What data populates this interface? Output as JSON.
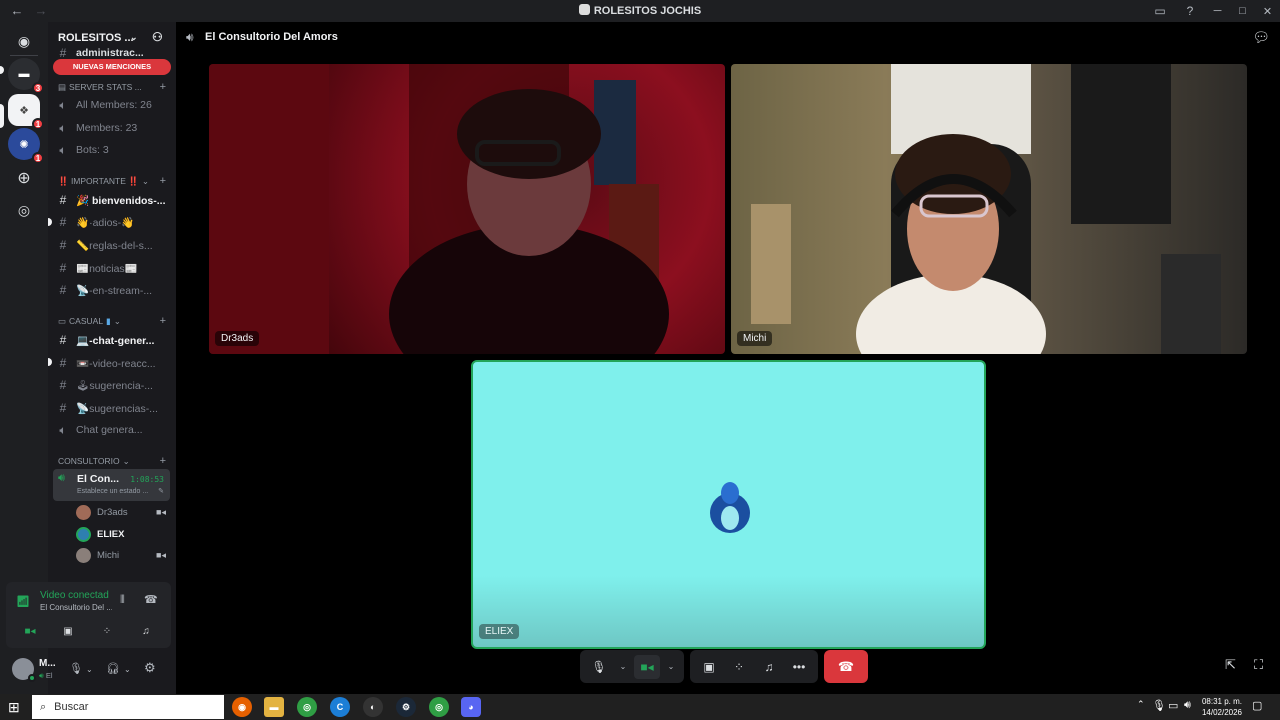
{
  "window": {
    "title": "ROLESITOS JOCHIS"
  },
  "rail": {
    "servers": [
      {
        "name": "direct-messages-icon"
      },
      {
        "badge": "3"
      },
      {
        "badge": "1"
      },
      {
        "badge": "1"
      }
    ]
  },
  "sidebar": {
    "server_name": "ROLESITOS ...",
    "top_channel": "administrac...",
    "top_channel_badge": "1",
    "new_mentions": "NUEVAS MENCIONES",
    "categories": {
      "stats": "SERVER STATS ...",
      "importante": "‼️ IMPORTANTE ‼️",
      "casual": "CASUAL",
      "consultorio": "CONSULTORIO"
    },
    "stats_channels": [
      "All Members: 26",
      "Members: 23",
      "Bots: 3"
    ],
    "importante_channels": [
      "🎉 bienvenidos-...",
      "👋·adios-👋",
      "📏reglas-del-s...",
      "📰noticias📰",
      "📡-en-stream-..."
    ],
    "casual_channels": [
      "💻-chat-gener...",
      "📼-video-reacc...",
      "🕹sugerencia-...",
      "📡sugerencias-...",
      "Chat genera..."
    ],
    "active_voice": {
      "name": "El Con...",
      "timer": "1:08:53",
      "status": "Establece un estado ..."
    },
    "voice_users": [
      "Dr3ads",
      "ELIEX",
      "Michi"
    ]
  },
  "voice_panel": {
    "title": "Video conectad",
    "subtitle": "El Consultorio Del ..."
  },
  "user_panel": {
    "name": "M...",
    "status": "El"
  },
  "main": {
    "channel_name": "El Consultorio Del Amors",
    "participants": [
      {
        "name": "Dr3ads"
      },
      {
        "name": "Michi"
      },
      {
        "name": "ELIEX"
      }
    ]
  },
  "taskbar": {
    "search_placeholder": "Buscar",
    "time": "08:31 p. m.",
    "date": "14/02/2026"
  },
  "colors": {
    "accent_green": "#23a559",
    "danger_red": "#da373c",
    "eliex_tile": "#7ff0ec"
  }
}
